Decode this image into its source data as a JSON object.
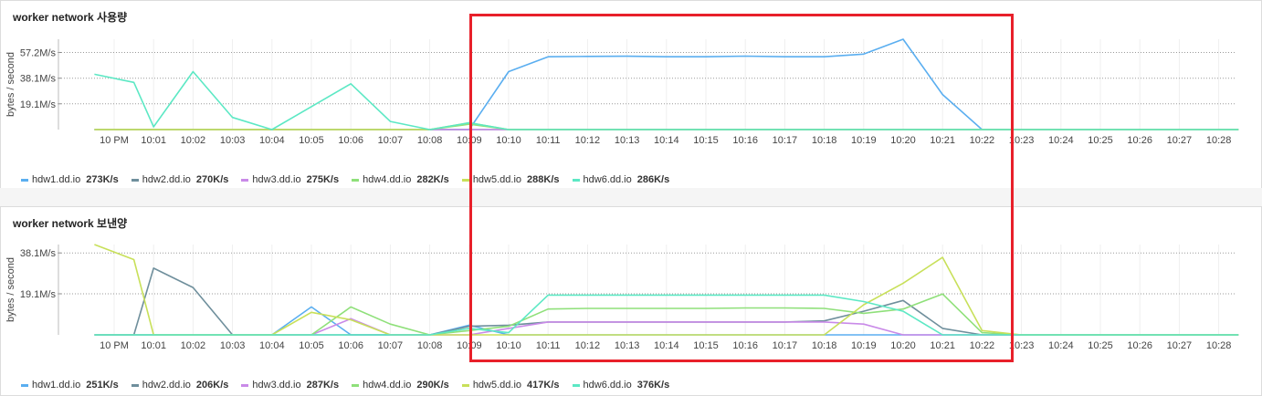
{
  "colors": {
    "hdw1.dd.io": "#5aaef0",
    "hdw2.dd.io": "#6f8f9c",
    "hdw3.dd.io": "#c98ae8",
    "hdw4.dd.io": "#8fe07a",
    "hdw5.dd.io": "#c8e05a",
    "hdw6.dd.io": "#5ce8c4",
    "highlight": "#e8202a"
  },
  "chart_data": [
    {
      "type": "line",
      "title": "worker network 사용량",
      "ylabel": "bytes / second",
      "y_ticks": [
        {
          "value": 19.1,
          "label": "19.1M/s"
        },
        {
          "value": 38.1,
          "label": "38.1M/s"
        },
        {
          "value": 57.2,
          "label": "57.2M/s"
        }
      ],
      "ylim": [
        0,
        67
      ],
      "grid": true,
      "legend_position": "bottom-left",
      "x_labels": [
        "10 PM",
        "10:01",
        "10:02",
        "10:03",
        "10:04",
        "10:05",
        "10:06",
        "10:07",
        "10:08",
        "10:09",
        "10:10",
        "10:11",
        "10:12",
        "10:13",
        "10:14",
        "10:15",
        "10:16",
        "10:17",
        "10:18",
        "10:19",
        "10:20",
        "10:21",
        "10:22",
        "10:23",
        "10:24",
        "10:25",
        "10:26",
        "10:27",
        "10:28"
      ],
      "series": [
        {
          "name": "hdw1.dd.io",
          "legend_value": "273K/s",
          "points": [
            [
              -0.5,
              0
            ],
            [
              8.0,
              0
            ],
            [
              9.0,
              0
            ],
            [
              10.0,
              43
            ],
            [
              11.0,
              54
            ],
            [
              12.0,
              54.3
            ],
            [
              13.0,
              54.4
            ],
            [
              14.0,
              54
            ],
            [
              15.0,
              54
            ],
            [
              16.0,
              54.5
            ],
            [
              17.0,
              54
            ],
            [
              18.0,
              54
            ],
            [
              19.0,
              56
            ],
            [
              20.0,
              67
            ],
            [
              21.0,
              26
            ],
            [
              22.0,
              0
            ],
            [
              28.5,
              0
            ]
          ]
        },
        {
          "name": "hdw2.dd.io",
          "legend_value": "270K/s",
          "points": [
            [
              -0.5,
              0
            ],
            [
              28.5,
              0
            ]
          ]
        },
        {
          "name": "hdw3.dd.io",
          "legend_value": "275K/s",
          "points": [
            [
              -0.5,
              0
            ],
            [
              28.5,
              0
            ]
          ]
        },
        {
          "name": "hdw4.dd.io",
          "legend_value": "282K/s",
          "points": [
            [
              -0.5,
              0
            ],
            [
              8.0,
              0
            ],
            [
              9.0,
              4
            ],
            [
              10.0,
              0
            ],
            [
              28.5,
              0
            ]
          ]
        },
        {
          "name": "hdw5.dd.io",
          "legend_value": "288K/s",
          "points": [
            [
              -0.5,
              0
            ],
            [
              8.0,
              0
            ],
            [
              9.0,
              5
            ],
            [
              10.0,
              0
            ],
            [
              28.5,
              0
            ]
          ]
        },
        {
          "name": "hdw6.dd.io",
          "legend_value": "286K/s",
          "points": [
            [
              -0.5,
              41
            ],
            [
              0.5,
              35
            ],
            [
              1.0,
              2
            ],
            [
              2.0,
              43
            ],
            [
              3.0,
              9
            ],
            [
              4.0,
              0
            ],
            [
              6.0,
              34
            ],
            [
              7.0,
              6
            ],
            [
              8.0,
              0
            ],
            [
              9.0,
              5
            ],
            [
              10.0,
              0
            ],
            [
              28.5,
              0
            ]
          ]
        }
      ]
    },
    {
      "type": "line",
      "title": "worker network 보낸양",
      "ylabel": "bytes / second",
      "y_ticks": [
        {
          "value": 19.1,
          "label": "19.1M/s"
        },
        {
          "value": 38.1,
          "label": "38.1M/s"
        }
      ],
      "ylim": [
        0,
        42
      ],
      "grid": true,
      "legend_position": "bottom-left",
      "x_labels": [
        "10 PM",
        "10:01",
        "10:02",
        "10:03",
        "10:04",
        "10:05",
        "10:06",
        "10:07",
        "10:08",
        "10:09",
        "10:10",
        "10:11",
        "10:12",
        "10:13",
        "10:14",
        "10:15",
        "10:16",
        "10:17",
        "10:18",
        "10:19",
        "10:20",
        "10:21",
        "10:22",
        "10:23",
        "10:24",
        "10:25",
        "10:26",
        "10:27",
        "10:28"
      ],
      "series": [
        {
          "name": "hdw1.dd.io",
          "legend_value": "251K/s",
          "points": [
            [
              -0.5,
              0
            ],
            [
              4.0,
              0
            ],
            [
              5.0,
              13
            ],
            [
              6.0,
              0
            ],
            [
              8.0,
              0
            ],
            [
              9.0,
              4.5
            ],
            [
              10.0,
              0
            ],
            [
              28.5,
              0
            ]
          ]
        },
        {
          "name": "hdw2.dd.io",
          "legend_value": "206K/s",
          "points": [
            [
              -0.5,
              0
            ],
            [
              0.5,
              0
            ],
            [
              1.0,
              31
            ],
            [
              2.0,
              22
            ],
            [
              3.0,
              0
            ],
            [
              8.0,
              0
            ],
            [
              9.0,
              4
            ],
            [
              10.0,
              4.5
            ],
            [
              11.0,
              6
            ],
            [
              12.0,
              6
            ],
            [
              13.0,
              6
            ],
            [
              14.0,
              6
            ],
            [
              15.0,
              6
            ],
            [
              16.0,
              6
            ],
            [
              17.0,
              6
            ],
            [
              18.0,
              6.5
            ],
            [
              19.0,
              11
            ],
            [
              20.0,
              16
            ],
            [
              21.0,
              3
            ],
            [
              22.0,
              0
            ],
            [
              28.5,
              0
            ]
          ]
        },
        {
          "name": "hdw3.dd.io",
          "legend_value": "287K/s",
          "points": [
            [
              -0.5,
              0
            ],
            [
              5.0,
              0
            ],
            [
              6.0,
              7.5
            ],
            [
              7.0,
              0
            ],
            [
              9.0,
              0
            ],
            [
              10.0,
              3
            ],
            [
              11.0,
              6
            ],
            [
              12.0,
              6
            ],
            [
              13.0,
              6
            ],
            [
              14.0,
              6
            ],
            [
              15.0,
              6
            ],
            [
              16.0,
              6
            ],
            [
              17.0,
              6
            ],
            [
              18.0,
              6
            ],
            [
              19.0,
              5
            ],
            [
              20.0,
              0
            ],
            [
              28.5,
              0
            ]
          ]
        },
        {
          "name": "hdw4.dd.io",
          "legend_value": "290K/s",
          "points": [
            [
              -0.5,
              0
            ],
            [
              5.0,
              0
            ],
            [
              6.0,
              13
            ],
            [
              7.0,
              5
            ],
            [
              8.0,
              0
            ],
            [
              9.0,
              2
            ],
            [
              10.0,
              4
            ],
            [
              11.0,
              12
            ],
            [
              12.0,
              12.3
            ],
            [
              13.0,
              12.3
            ],
            [
              14.0,
              12.3
            ],
            [
              15.0,
              12.3
            ],
            [
              16.0,
              12.5
            ],
            [
              17.0,
              12.5
            ],
            [
              18.0,
              12.3
            ],
            [
              19.0,
              10
            ],
            [
              20.0,
              12
            ],
            [
              21.0,
              19
            ],
            [
              22.0,
              1
            ],
            [
              23.0,
              0
            ],
            [
              28.5,
              0
            ]
          ]
        },
        {
          "name": "hdw5.dd.io",
          "legend_value": "417K/s",
          "points": [
            [
              -0.5,
              42
            ],
            [
              0.5,
              35
            ],
            [
              1.0,
              0
            ],
            [
              4.0,
              0
            ],
            [
              5.0,
              10.5
            ],
            [
              6.0,
              7
            ],
            [
              7.0,
              0
            ],
            [
              9.0,
              0
            ],
            [
              10.0,
              0
            ],
            [
              18.0,
              0
            ],
            [
              19.0,
              14
            ],
            [
              20.0,
              24
            ],
            [
              21.0,
              36
            ],
            [
              22.0,
              2
            ],
            [
              23.0,
              0
            ],
            [
              28.5,
              0
            ]
          ]
        },
        {
          "name": "hdw6.dd.io",
          "legend_value": "376K/s",
          "points": [
            [
              -0.5,
              0
            ],
            [
              8.0,
              0
            ],
            [
              9.0,
              3
            ],
            [
              10.0,
              1
            ],
            [
              11.0,
              18.5
            ],
            [
              12.0,
              18.5
            ],
            [
              13.0,
              18.5
            ],
            [
              14.0,
              18.5
            ],
            [
              15.0,
              18.5
            ],
            [
              16.0,
              18.5
            ],
            [
              17.0,
              18.5
            ],
            [
              18.0,
              18.5
            ],
            [
              19.0,
              15.5
            ],
            [
              20.0,
              11
            ],
            [
              21.0,
              0
            ],
            [
              28.5,
              0
            ]
          ]
        }
      ]
    }
  ]
}
